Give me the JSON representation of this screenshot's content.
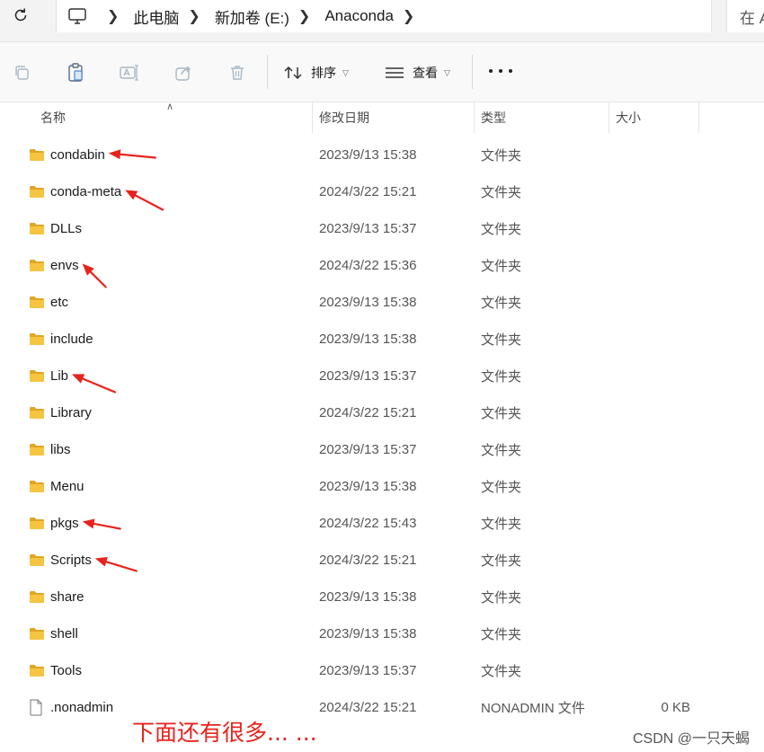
{
  "address_bar": {
    "breadcrumbs": [
      "此电脑",
      "新加卷 (E:)",
      "Anaconda"
    ],
    "search_placeholder": "在 A"
  },
  "toolbar": {
    "sort_label": "排序",
    "view_label": "查看"
  },
  "columns": {
    "name": "名称",
    "date": "修改日期",
    "type": "类型",
    "size": "大小"
  },
  "rows": [
    {
      "name": "condabin",
      "date": "2023/9/13 15:38",
      "type": "文件夹",
      "size": "",
      "icon": "folder-icon",
      "highlighted": true
    },
    {
      "name": "conda-meta",
      "date": "2024/3/22 15:21",
      "type": "文件夹",
      "size": "",
      "icon": "folder-icon",
      "highlighted": true
    },
    {
      "name": "DLLs",
      "date": "2023/9/13 15:37",
      "type": "文件夹",
      "size": "",
      "icon": "folder-icon",
      "highlighted": false
    },
    {
      "name": "envs",
      "date": "2024/3/22 15:36",
      "type": "文件夹",
      "size": "",
      "icon": "folder-icon",
      "highlighted": true
    },
    {
      "name": "etc",
      "date": "2023/9/13 15:38",
      "type": "文件夹",
      "size": "",
      "icon": "folder-icon",
      "highlighted": false
    },
    {
      "name": "include",
      "date": "2023/9/13 15:38",
      "type": "文件夹",
      "size": "",
      "icon": "folder-icon",
      "highlighted": false
    },
    {
      "name": "Lib",
      "date": "2023/9/13 15:37",
      "type": "文件夹",
      "size": "",
      "icon": "folder-icon",
      "highlighted": true
    },
    {
      "name": "Library",
      "date": "2024/3/22 15:21",
      "type": "文件夹",
      "size": "",
      "icon": "folder-icon",
      "highlighted": false
    },
    {
      "name": "libs",
      "date": "2023/9/13 15:37",
      "type": "文件夹",
      "size": "",
      "icon": "folder-icon",
      "highlighted": false
    },
    {
      "name": "Menu",
      "date": "2023/9/13 15:38",
      "type": "文件夹",
      "size": "",
      "icon": "folder-icon",
      "highlighted": false
    },
    {
      "name": "pkgs",
      "date": "2024/3/22 15:43",
      "type": "文件夹",
      "size": "",
      "icon": "folder-icon",
      "highlighted": true
    },
    {
      "name": "Scripts",
      "date": "2024/3/22 15:21",
      "type": "文件夹",
      "size": "",
      "icon": "folder-icon",
      "highlighted": true
    },
    {
      "name": "share",
      "date": "2023/9/13 15:38",
      "type": "文件夹",
      "size": "",
      "icon": "folder-icon",
      "highlighted": false
    },
    {
      "name": "shell",
      "date": "2023/9/13 15:38",
      "type": "文件夹",
      "size": "",
      "icon": "folder-icon",
      "highlighted": false
    },
    {
      "name": "Tools",
      "date": "2023/9/13 15:37",
      "type": "文件夹",
      "size": "",
      "icon": "folder-icon",
      "highlighted": false
    },
    {
      "name": ".nonadmin",
      "date": "2024/3/22 15:21",
      "type": "NONADMIN 文件",
      "size": "0 KB",
      "icon": "file-icon",
      "highlighted": false
    }
  ],
  "annotation": {
    "note": "下面还有很多... ...",
    "arrow_color": "#e8231c"
  },
  "watermark": "CSDN @一只天蝎",
  "colors": {
    "folder": "#f5c542",
    "folder_dark": "#e0a526",
    "accent_red": "#e8231c"
  }
}
